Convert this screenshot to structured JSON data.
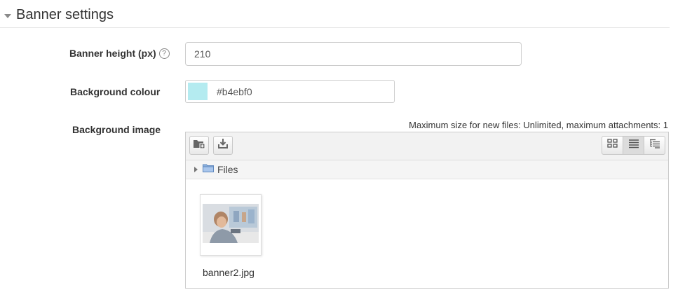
{
  "section": {
    "title": "Banner settings"
  },
  "banner_height": {
    "label": "Banner height (px)",
    "help_icon": "question-circle-icon",
    "help_glyph": "?",
    "value": "210"
  },
  "background_colour": {
    "label": "Background colour",
    "value": "#b4ebf0",
    "swatch_color": "#b4ebf0"
  },
  "background_image": {
    "label": "Background image",
    "limits_text": "Maximum size for new files: Unlimited, maximum attachments: 1",
    "toolbar": {
      "add_icon": "add-folder-icon",
      "download_icon": "download-icon",
      "views": [
        {
          "name": "icon-view",
          "icon": "grid-icon",
          "active": false
        },
        {
          "name": "list-view",
          "icon": "list-icon",
          "active": true
        },
        {
          "name": "tree-view",
          "icon": "tree-icon",
          "active": false
        }
      ]
    },
    "path": {
      "label": "Files",
      "icon": "folder-icon"
    },
    "files": [
      {
        "name": "banner2.jpg",
        "icon": "image-thumbnail"
      }
    ]
  },
  "colors": {
    "border": "#cccccc",
    "toolbar_bg": "#f2f2f2",
    "folder_blue": "#7fa6d8"
  }
}
